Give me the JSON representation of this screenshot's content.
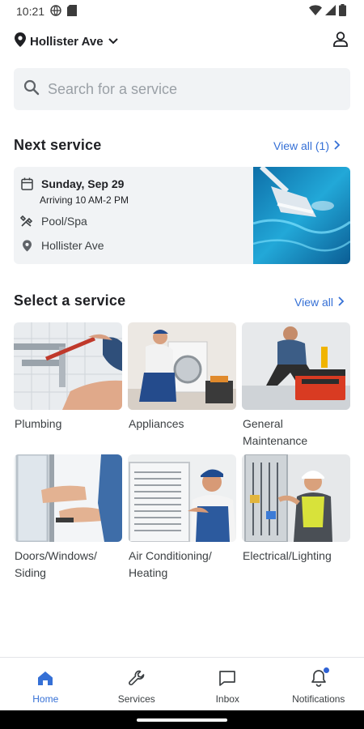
{
  "status_bar": {
    "time": "10:21"
  },
  "header": {
    "location": "Hollister Ave"
  },
  "search": {
    "placeholder": "Search for a service",
    "value": ""
  },
  "next_service": {
    "title": "Next service",
    "view_all": "View all (1)",
    "date": "Sunday, Sep 29",
    "arriving": "Arriving 10 AM-2 PM",
    "service": "Pool/Spa",
    "address": "Hollister Ave"
  },
  "select_service": {
    "title": "Select a service",
    "view_all": "View all",
    "tiles": [
      {
        "label": "Plumbing"
      },
      {
        "label": "Appliances"
      },
      {
        "label": "General Maintenance"
      },
      {
        "label": "Doors/Windows/ Siding"
      },
      {
        "label": "Air Conditioning/ Heating"
      },
      {
        "label": "Electrical/Lighting"
      }
    ]
  },
  "bottom_nav": {
    "items": [
      {
        "label": "Home",
        "icon": "home-icon",
        "active": true
      },
      {
        "label": "Services",
        "icon": "wrench-icon"
      },
      {
        "label": "Inbox",
        "icon": "chat-bubble-icon"
      },
      {
        "label": "Notifications",
        "icon": "bell-icon",
        "badge": true
      }
    ]
  },
  "colors": {
    "accent": "#3570d6",
    "card_bg": "#f1f3f5",
    "text": "#1f2024",
    "badge": "#2f62d4"
  }
}
